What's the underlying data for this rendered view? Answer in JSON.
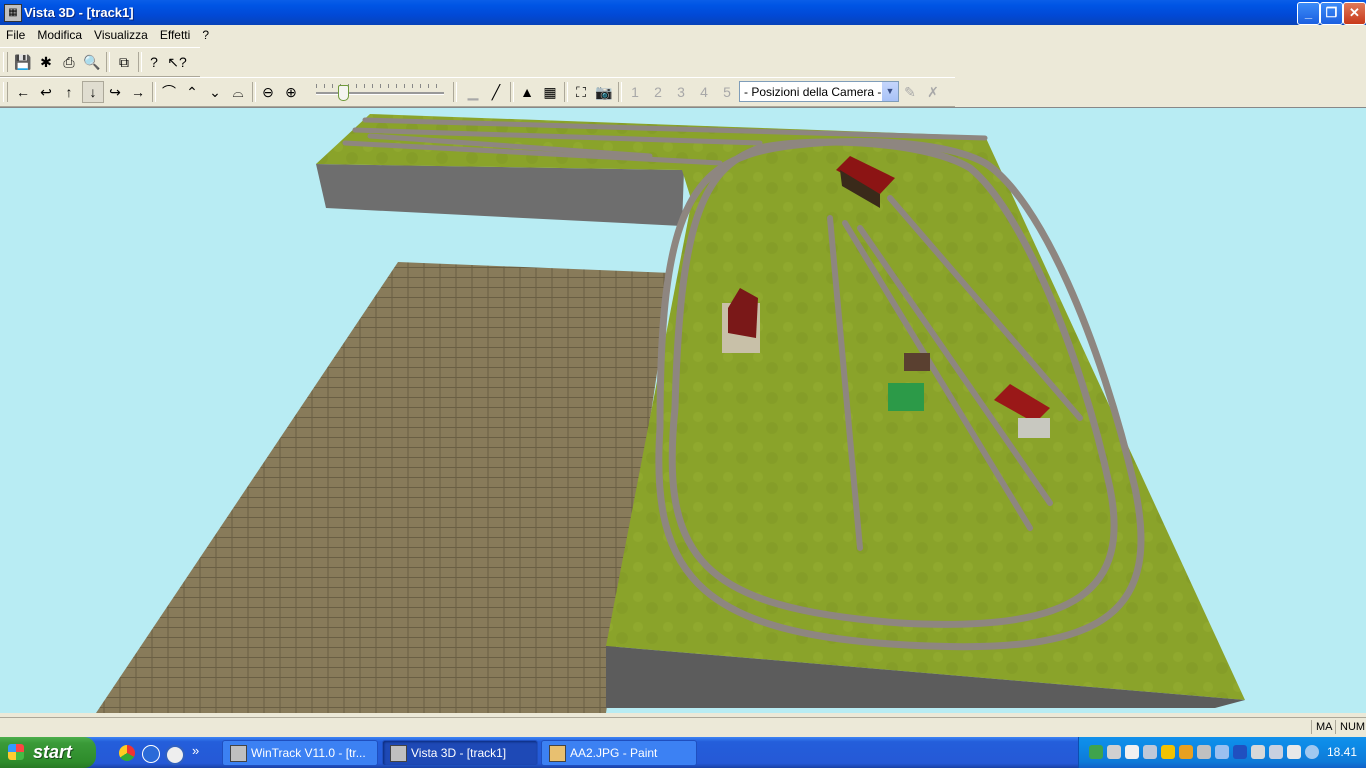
{
  "window": {
    "title": "Vista 3D - [track1]"
  },
  "menu": [
    "File",
    "Modifica",
    "Visualizza",
    "Effetti",
    "?"
  ],
  "toolbar": {
    "camera_select_value": "- Posizioni della Camera -",
    "camera_presets": [
      "1",
      "2",
      "3",
      "4",
      "5"
    ]
  },
  "statusbar": {
    "caps": "MA",
    "num": "NUM"
  },
  "taskbar": {
    "start_label": "start",
    "tasks": [
      "WinTrack  V11.0 - [tr...",
      "Vista 3D - [track1]",
      "AA2.JPG - Paint"
    ],
    "clock": "18.41",
    "quicklaunch_more": "»"
  }
}
